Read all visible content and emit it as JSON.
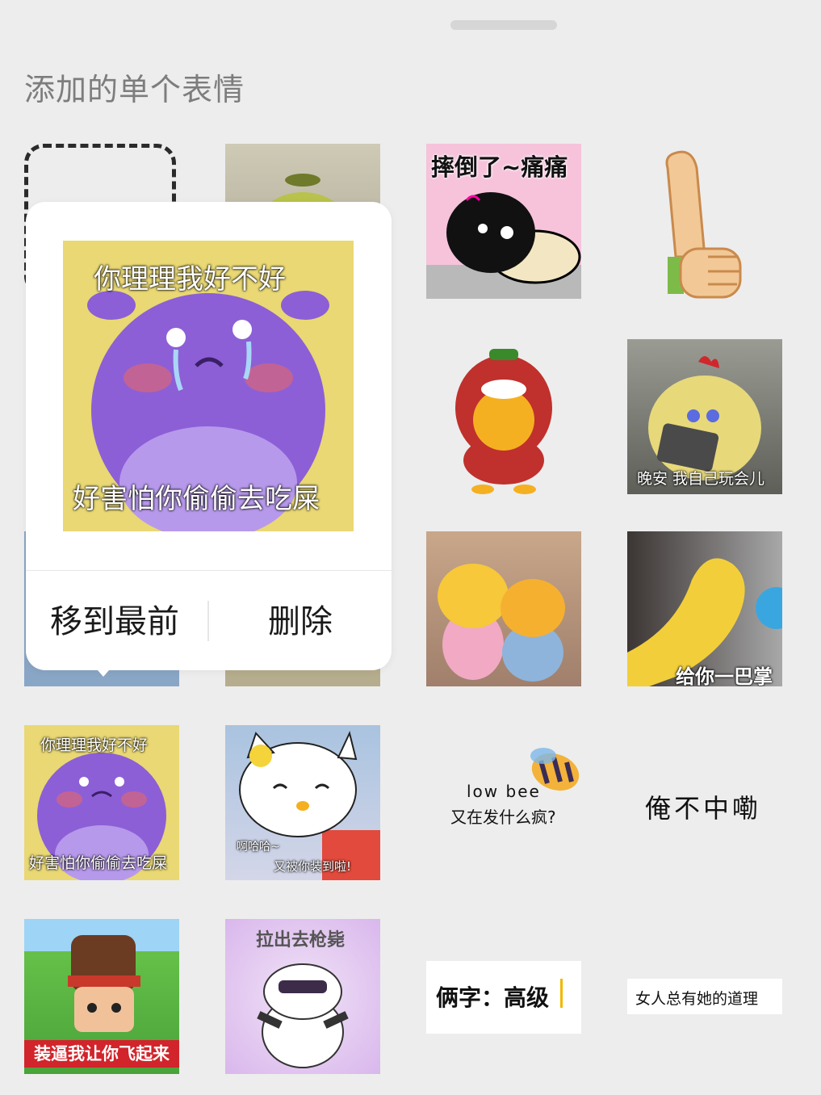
{
  "section_title": "添加的单个表情",
  "stickers": [
    {
      "caption": "摔倒了~痛痛"
    },
    {
      "caption": "晚安 我自己玩会儿"
    },
    {
      "caption": "给你一巴掌"
    },
    {
      "caption_line1": "low bee",
      "caption_line2": "又在发什么疯?"
    },
    {
      "caption": "俺不中嘞"
    },
    {
      "caption_top": "你理理我好不好",
      "caption_bottom": "好害怕你偷偷去吃屎"
    },
    {
      "caption_line1": "啊哈哈~",
      "caption_line2": "又被你装到啦!"
    },
    {
      "caption": "装逼我让你飞起来"
    },
    {
      "caption": "拉出去枪毙"
    },
    {
      "caption": "俩字：高级"
    },
    {
      "caption": "女人总有她的道理"
    }
  ],
  "context_menu": {
    "preview_caption_top": "你理理我好不好",
    "preview_caption_bottom": "好害怕你偷偷去吃屎",
    "move_to_front": "移到最前",
    "delete": "删除"
  },
  "colors": {
    "background": "#ededed",
    "popup": "#ffffff",
    "title_gray": "#7d7d7d"
  }
}
